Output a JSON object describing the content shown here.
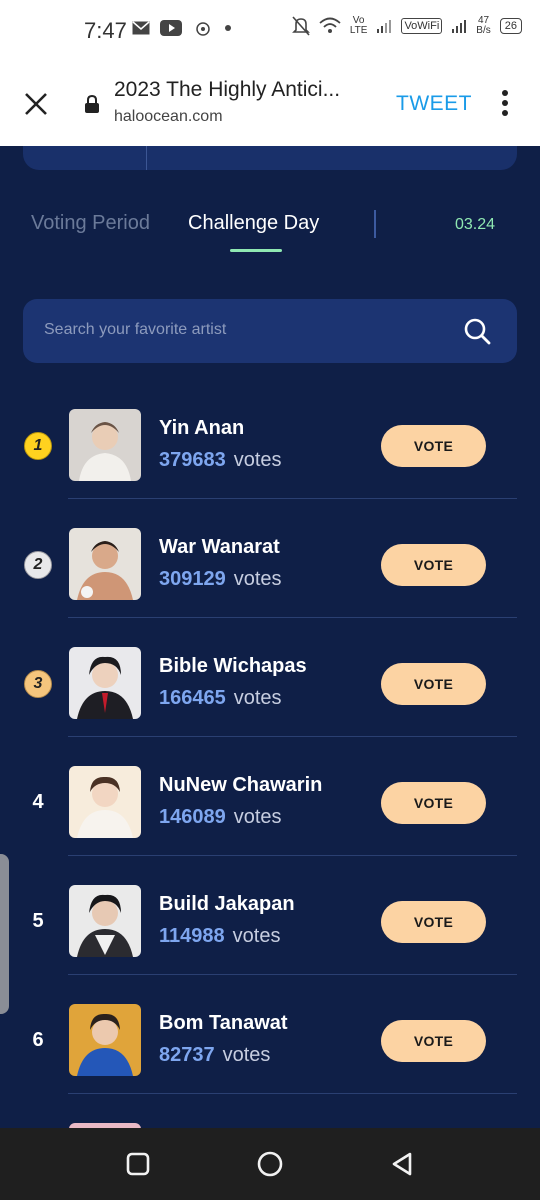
{
  "status_bar": {
    "time": "7:47",
    "network_label": "Vo\nLTE",
    "vowifi_label": "VoWiFi",
    "speed_value": "47",
    "speed_unit": "B/s",
    "battery": "26"
  },
  "browser": {
    "title": "2023 The Highly Antici...",
    "url": "haloocean.com",
    "tweet_label": "TWEET"
  },
  "tabs": {
    "voting": "Voting Period",
    "challenge": "Challenge Day",
    "date": "03.24"
  },
  "search": {
    "placeholder": "Search your favorite artist"
  },
  "vote_label": "VOTE",
  "votes_word": "votes",
  "artists": [
    {
      "rank": "1",
      "name": "Yin Anan",
      "votes": "379683"
    },
    {
      "rank": "2",
      "name": "War Wanarat",
      "votes": "309129"
    },
    {
      "rank": "3",
      "name": "Bible Wichapas",
      "votes": "166465"
    },
    {
      "rank": "4",
      "name": "NuNew Chawarin",
      "votes": "146089"
    },
    {
      "rank": "5",
      "name": "Build Jakapan",
      "votes": "114988"
    },
    {
      "rank": "6",
      "name": "Bom Tanawat",
      "votes": "82737"
    }
  ],
  "colors": {
    "background": "#0f1f47",
    "accent_green": "#8fe8b2",
    "vote_button": "#fcd3a3",
    "vote_number": "#7ea6ef",
    "tweet": "#1a9be8"
  }
}
